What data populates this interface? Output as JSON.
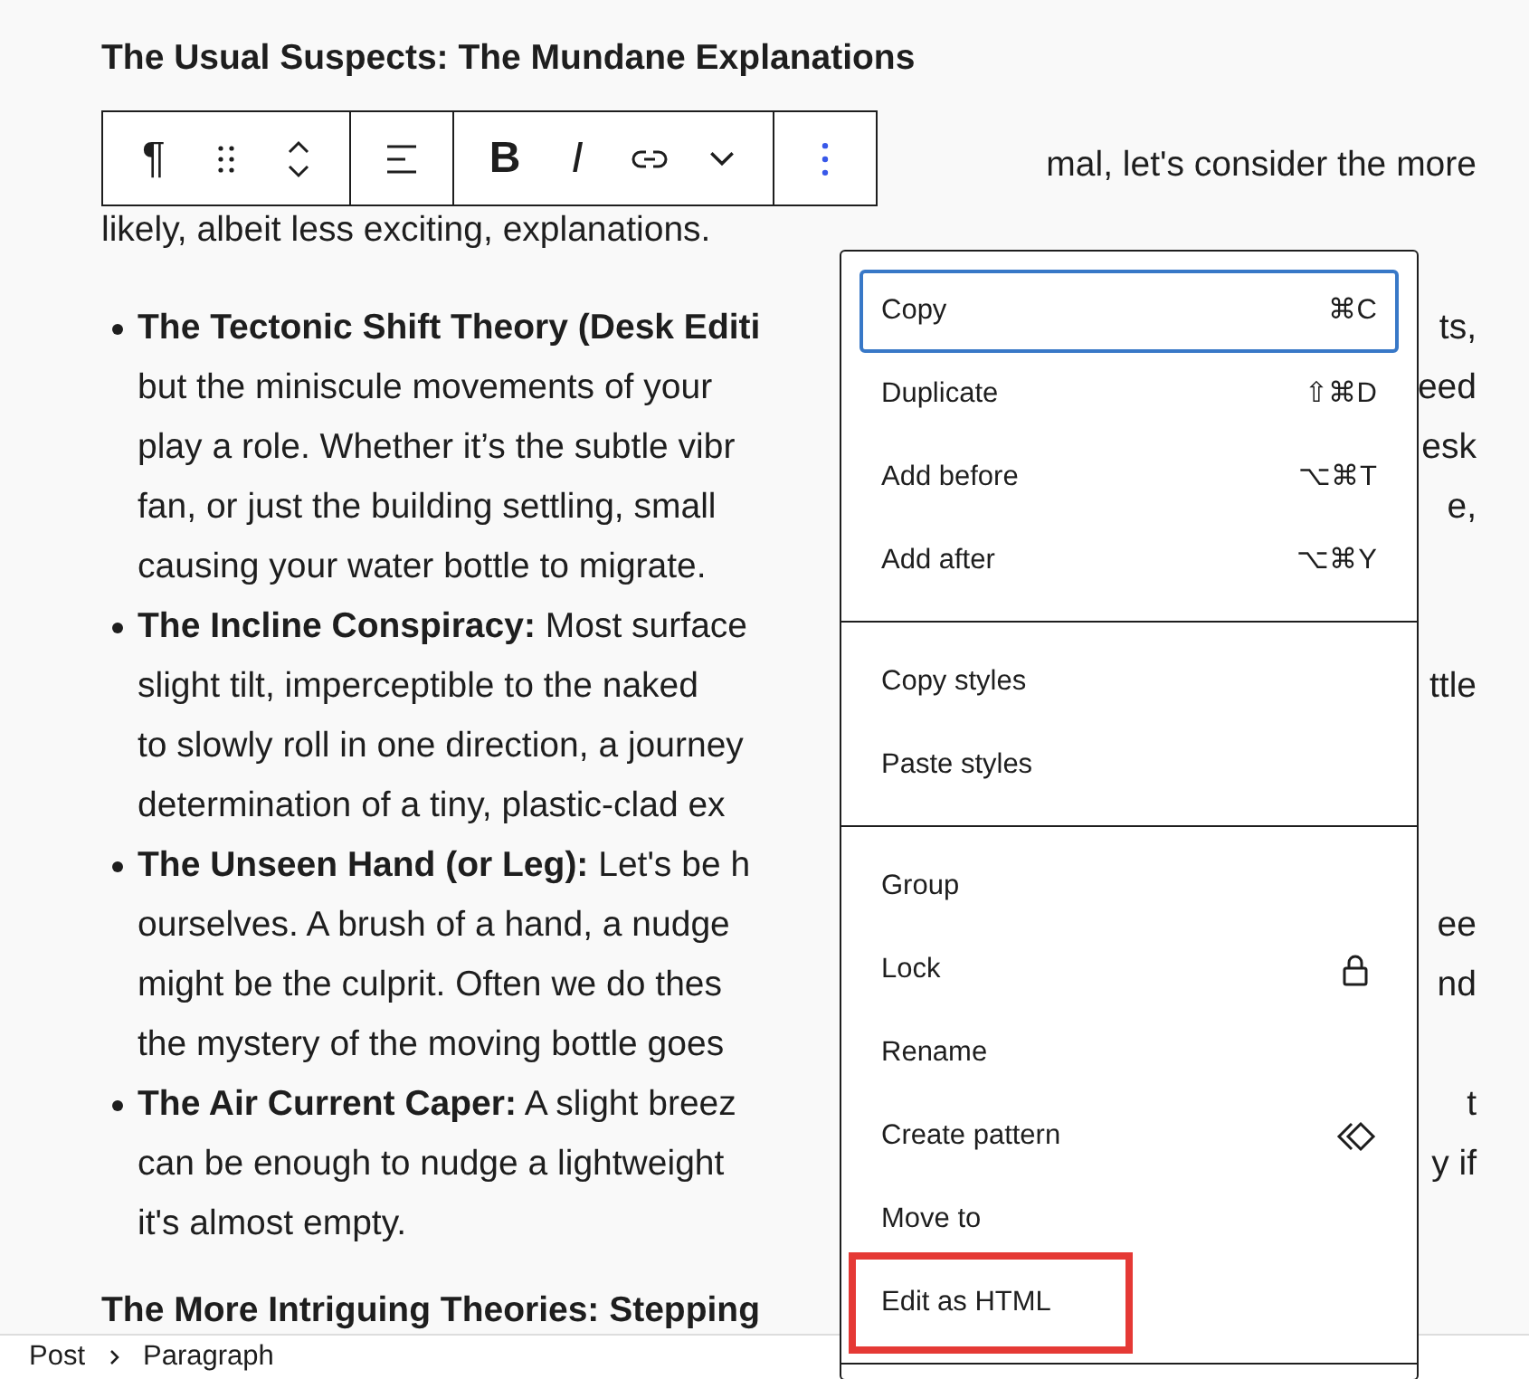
{
  "article": {
    "heading": "The Usual Suspects: The Mundane Explanations",
    "intro_lines": [
      {
        "right": "mal, let's consider the more"
      },
      {
        "left": "likely, albeit less exciting, explanations."
      }
    ],
    "bullets": [
      {
        "lines": [
          {
            "left": "**The Tectonic Shift Theory (Desk Editi**",
            "right": "ts,"
          },
          {
            "left": "but the miniscule movements of your",
            "right": "eed"
          },
          {
            "left": "play a role. Whether it’s the subtle vibr",
            "right": "esk"
          },
          {
            "left": "fan, or just the building settling, small",
            "right": "e,"
          },
          {
            "left": "causing your water bottle to migrate."
          }
        ]
      },
      {
        "lines": [
          {
            "left": "**The Incline Conspiracy:** Most surface"
          },
          {
            "left": "slight tilt, imperceptible to the naked",
            "right": "ttle"
          },
          {
            "left": "to slowly roll in one direction, a journey"
          },
          {
            "left": "determination of a tiny, plastic-clad ex"
          }
        ]
      },
      {
        "lines": [
          {
            "left": "**The Unseen Hand (or Leg):** Let's be h"
          },
          {
            "left": "ourselves. A brush of a hand, a nudge",
            "right": "ee"
          },
          {
            "left": "might be the culprit. Often we do thes",
            "right": "nd"
          },
          {
            "left": "the mystery of the moving bottle goes"
          }
        ]
      },
      {
        "lines": [
          {
            "left": "**The Air Current Caper:** A slight breez",
            "right": "t"
          },
          {
            "left": "can be enough to nudge a lightweight",
            "right": "y if"
          },
          {
            "left": "it's almost empty."
          }
        ]
      }
    ],
    "next_heading": "The More Intriguing Theories: Stepping"
  },
  "block_toolbar": {
    "groups": [
      [
        {
          "kind": "glyph",
          "label": "¶"
        },
        {
          "kind": "drag"
        },
        {
          "kind": "mover"
        }
      ],
      [
        {
          "kind": "align"
        }
      ],
      [
        {
          "kind": "bold",
          "label": "B"
        },
        {
          "kind": "italic",
          "label": "I"
        },
        {
          "kind": "link"
        },
        {
          "kind": "more-down"
        }
      ],
      [
        {
          "kind": "options"
        }
      ]
    ]
  },
  "menu": {
    "sections": [
      {
        "items": [
          {
            "kind": "shortcut",
            "label": "Copy",
            "shortcut": "⌘C",
            "focused": true,
            "highlighted": false
          },
          {
            "kind": "shortcut",
            "label": "Duplicate",
            "shortcut": "⇧⌘D",
            "focused": false,
            "highlighted": false
          },
          {
            "kind": "shortcut",
            "label": "Add before",
            "shortcut": "⌥⌘T",
            "focused": false,
            "highlighted": false
          },
          {
            "kind": "shortcut",
            "label": "Add after",
            "shortcut": "⌥⌘Y",
            "focused": false,
            "highlighted": false
          }
        ]
      },
      {
        "items": [
          {
            "kind": "plain",
            "label": "Copy styles",
            "focused": false,
            "highlighted": false
          },
          {
            "kind": "plain",
            "label": "Paste styles",
            "focused": false,
            "highlighted": false
          }
        ]
      },
      {
        "items": [
          {
            "kind": "plain",
            "label": "Group",
            "focused": false,
            "highlighted": false
          },
          {
            "kind": "lock",
            "label": "Lock",
            "focused": false,
            "highlighted": false
          },
          {
            "kind": "plain",
            "label": "Rename",
            "focused": false,
            "highlighted": false
          },
          {
            "kind": "pattern",
            "label": "Create pattern",
            "focused": false,
            "highlighted": false
          },
          {
            "kind": "plain",
            "label": "Move to",
            "focused": false,
            "highlighted": false
          },
          {
            "kind": "plain",
            "label": "Edit as HTML",
            "focused": false,
            "highlighted": true
          }
        ]
      }
    ]
  },
  "status_bar": {
    "breadcrumbs": [
      "Post",
      "Paragraph"
    ]
  }
}
